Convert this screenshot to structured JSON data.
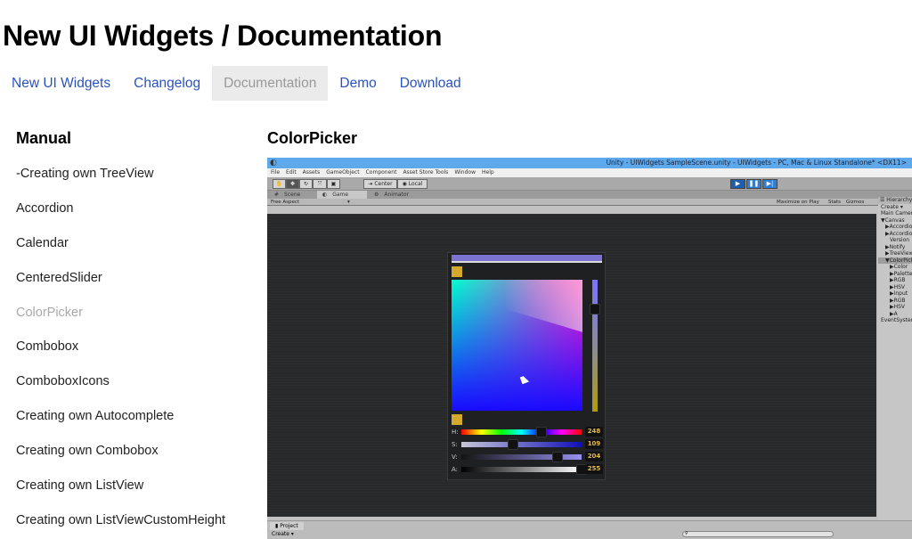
{
  "page": {
    "title": "New UI Widgets / Documentation"
  },
  "nav": [
    {
      "label": "New UI Widgets",
      "active": false
    },
    {
      "label": "Changelog",
      "active": false
    },
    {
      "label": "Documentation",
      "active": true
    },
    {
      "label": "Demo",
      "active": false
    },
    {
      "label": "Download",
      "active": false
    }
  ],
  "sidebar": {
    "title": "Manual",
    "items": [
      {
        "label": "-Creating own TreeView"
      },
      {
        "label": "Accordion"
      },
      {
        "label": "Calendar"
      },
      {
        "label": "CenteredSlider"
      },
      {
        "label": "ColorPicker",
        "current": true
      },
      {
        "label": "Combobox"
      },
      {
        "label": "ComboboxIcons"
      },
      {
        "label": "Creating own Autocomplete"
      },
      {
        "label": "Creating own Combobox"
      },
      {
        "label": "Creating own ListView"
      },
      {
        "label": "Creating own ListViewCustomHeight"
      }
    ]
  },
  "main": {
    "title": "ColorPicker"
  },
  "screenshot": {
    "window_title": "Unity - UIWidgets SampleScene.unity - UIWidgets - PC, Mac & Linux Standalone* <DX11>",
    "menu": [
      "File",
      "Edit",
      "Assets",
      "GameObject",
      "Component",
      "Asset Store Tools",
      "Window",
      "Help"
    ],
    "toolbar": {
      "center": "Center",
      "local": "Local"
    },
    "tabs": [
      "Scene",
      "Game",
      "Animator"
    ],
    "aspect": "Free Aspect",
    "game_buttons": [
      "Maximize on Play",
      "Stats",
      "Gizmos"
    ],
    "hierarchy": {
      "title": "Hierarchy",
      "create": "Create",
      "items": [
        "Main Camera",
        "Canvas",
        "Accordion",
        "Accordion",
        "Version",
        "Notify",
        "TreeView",
        "ColorPicker",
        "Color",
        "Palette",
        "RGB",
        "HSV",
        "Input",
        "RGB",
        "HSV",
        "A",
        "EventSystem"
      ]
    },
    "project": {
      "tab": "Project",
      "create": "Create"
    },
    "colorpicker": {
      "preview_color": "#7b73cf",
      "swatch_color": "#d4aa2e",
      "sliders": [
        {
          "label": "H:",
          "value": "248",
          "fraction": 0.67
        },
        {
          "label": "S:",
          "value": "109",
          "fraction": 0.43
        },
        {
          "label": "V:",
          "value": "204",
          "fraction": 0.8
        },
        {
          "label": "A:",
          "value": "255",
          "fraction": 1.0
        }
      ]
    }
  }
}
